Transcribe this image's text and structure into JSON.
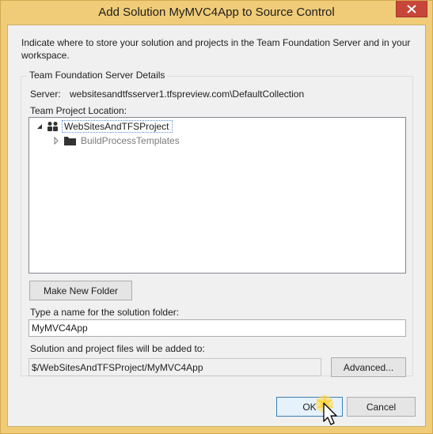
{
  "window": {
    "title": "Add Solution MyMVC4App to Source Control"
  },
  "intro_text": "Indicate where to store your solution and projects in the Team Foundation Server and in your workspace.",
  "group": {
    "legend": "Team Foundation Server Details",
    "server_label": "Server:",
    "server_value": "websitesandtfsserver1.tfspreview.com\\DefaultCollection",
    "location_label": "Team Project Location:"
  },
  "tree": {
    "root": {
      "label": "WebSitesAndTFSProject",
      "expanded": true,
      "selected": true,
      "icon": "team-project-icon"
    },
    "children": [
      {
        "label": "BuildProcessTemplates",
        "expanded": false,
        "icon": "folder-icon"
      }
    ]
  },
  "buttons": {
    "make_new_folder": "Make New Folder",
    "advanced": "Advanced...",
    "ok": "OK",
    "cancel": "Cancel"
  },
  "solution_folder": {
    "label": "Type a name for the solution folder:",
    "value": "MyMVC4App"
  },
  "files_destination": {
    "label": "Solution and project files will be added to:",
    "value": "$/WebSitesAndTFSProject/MyMVC4App"
  },
  "colors": {
    "title_bar": "#f0cc78",
    "close_button": "#c7463a",
    "selection_border": "#5b8fd6"
  }
}
